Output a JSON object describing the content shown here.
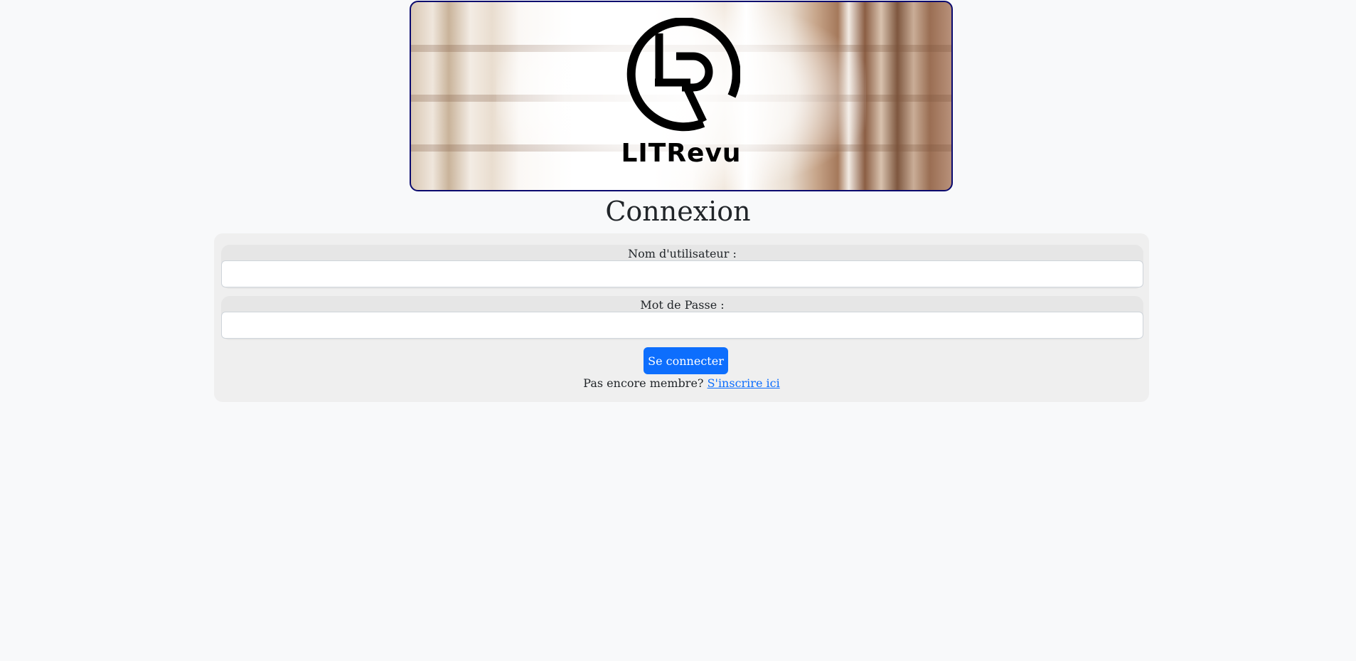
{
  "banner": {
    "logo_text": "LITRevu"
  },
  "page": {
    "title": "Connexion"
  },
  "form": {
    "username": {
      "label": "Nom d'utilisateur :",
      "value": "",
      "placeholder": ""
    },
    "password": {
      "label": "Mot de Passe :",
      "value": "",
      "placeholder": ""
    },
    "submit_label": "Se connecter",
    "signup_prompt": "Pas encore membre?",
    "signup_link": "S'inscrire ici"
  },
  "colors": {
    "accent": "#0d6efd",
    "banner_border": "#0a0a6e",
    "page_background": "#f8f9fa",
    "card_background": "#efefef"
  },
  "icons": {
    "logo": "lr-monogram-logo"
  }
}
